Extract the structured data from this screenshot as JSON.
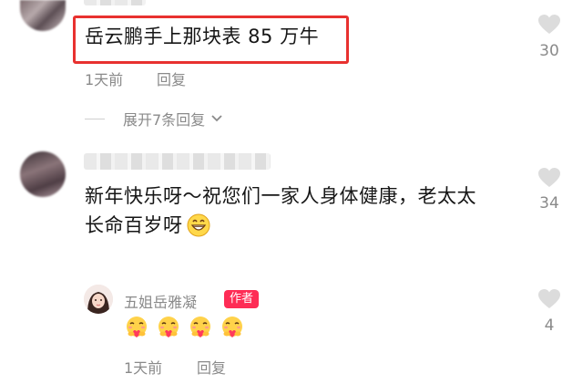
{
  "comments": [
    {
      "text": "岳云鹏手上那块表 85 万牛",
      "time": "1天前",
      "reply_label": "回复",
      "likes": "30"
    },
    {
      "text_line1": "新年快乐呀～祝您们一家人身体健康，老太太",
      "text_line2": "长命百岁呀",
      "likes": "34"
    }
  ],
  "expand": {
    "label": "展开7条回复"
  },
  "reply": {
    "author": "五姐岳雅凝",
    "badge": "作者",
    "emoji_count": 4,
    "time": "1天前",
    "reply_label": "回复",
    "likes": "4"
  },
  "colors": {
    "highlight": "#e8312f",
    "badge": "#fe2c55",
    "meta": "#8a8a8a"
  },
  "icons": [
    "heart-icon",
    "chevron-down-icon",
    "grin-emoji",
    "heart-hug-emoji"
  ]
}
